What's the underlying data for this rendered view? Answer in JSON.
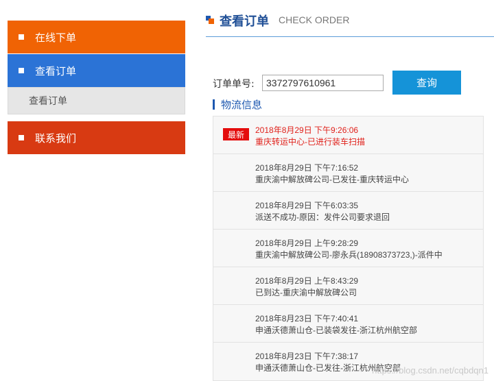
{
  "sidebar": {
    "order_online": "在线下单",
    "view_order": "查看订单",
    "view_order_sub": "查看订单",
    "contact_us": "联系我们"
  },
  "header": {
    "title": "查看订单",
    "subtitle": "CHECK ORDER"
  },
  "search": {
    "label": "订单单号:",
    "value": "3372797610961",
    "button": "查询"
  },
  "logistics": {
    "title": "物流信息",
    "latest_badge": "最新",
    "entries": [
      {
        "time": "2018年8月29日 下午9:26:06",
        "desc": "重庆转运中心-已进行装车扫描"
      },
      {
        "time": "2018年8月29日 下午7:16:52",
        "desc": "重庆渝中解放碑公司-已发往-重庆转运中心"
      },
      {
        "time": "2018年8月29日 下午6:03:35",
        "desc": "派送不成功-原因：发件公司要求退回"
      },
      {
        "time": "2018年8月29日 上午9:28:29",
        "desc": "重庆渝中解放碑公司-廖永兵(18908373723,)-派件中"
      },
      {
        "time": "2018年8月29日 上午8:43:29",
        "desc": "已到达-重庆渝中解放碑公司"
      },
      {
        "time": "2018年8月23日 下午7:40:41",
        "desc": "申通沃德萧山仓-已装袋发往-浙江杭州航空部"
      },
      {
        "time": "2018年8月23日 下午7:38:17",
        "desc": "申通沃德萧山仓-已发往-浙江杭州航空部"
      }
    ]
  },
  "watermark": "https://blog.csdn.net/cqbdqn1",
  "colors": {
    "orange": "#f06304",
    "blue": "#2b73d6",
    "red": "#d83a12",
    "query_button": "#1593d8",
    "latest_text": "#e0201a"
  }
}
